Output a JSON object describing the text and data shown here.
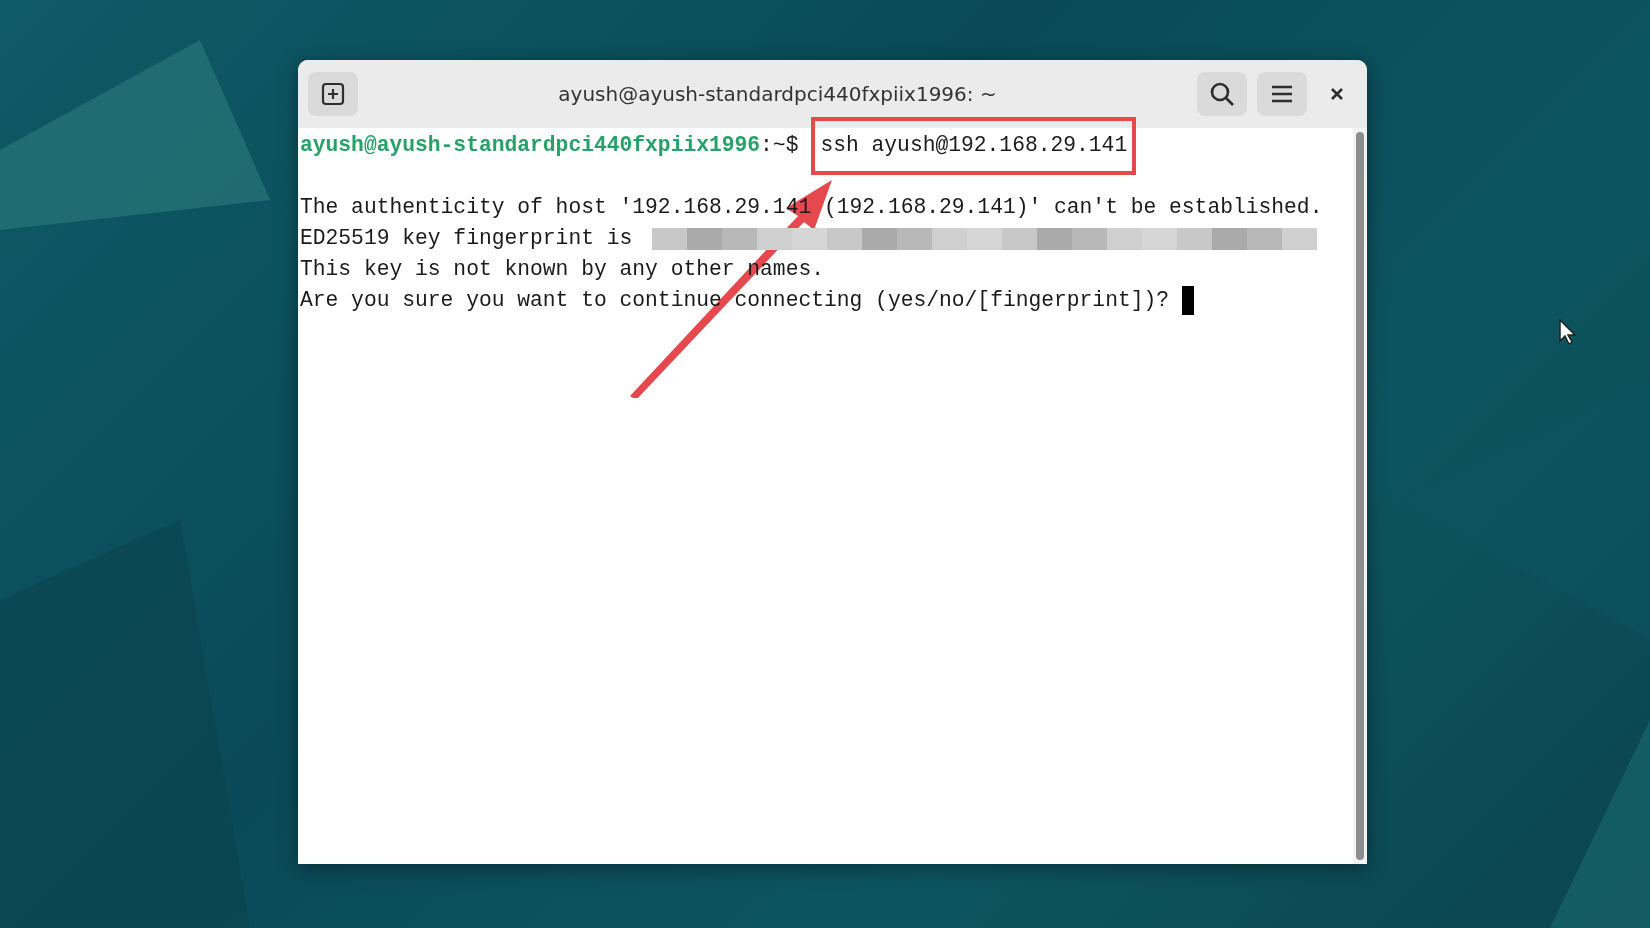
{
  "window": {
    "title": "ayush@ayush-standardpci440fxpiix1996: ~"
  },
  "terminal": {
    "prompt_user": "ayush@ayush-standardpci440fxpiix1996",
    "prompt_path": ":~$",
    "command": "ssh ayush@192.168.29.141",
    "command_highlighted": true,
    "lines": [
      {
        "kind": "blank"
      },
      {
        "kind": "text",
        "text": "The authenticity of host '192.168.29.141 (192.168.29.141)' can't be established."
      },
      {
        "kind": "redacted",
        "text": "ED25519 key fingerprint is"
      },
      {
        "kind": "text",
        "text": "This key is not known by any other names."
      },
      {
        "kind": "question",
        "text": "Are you sure you want to continue connecting (yes/no/[fingerprint])?"
      }
    ]
  }
}
